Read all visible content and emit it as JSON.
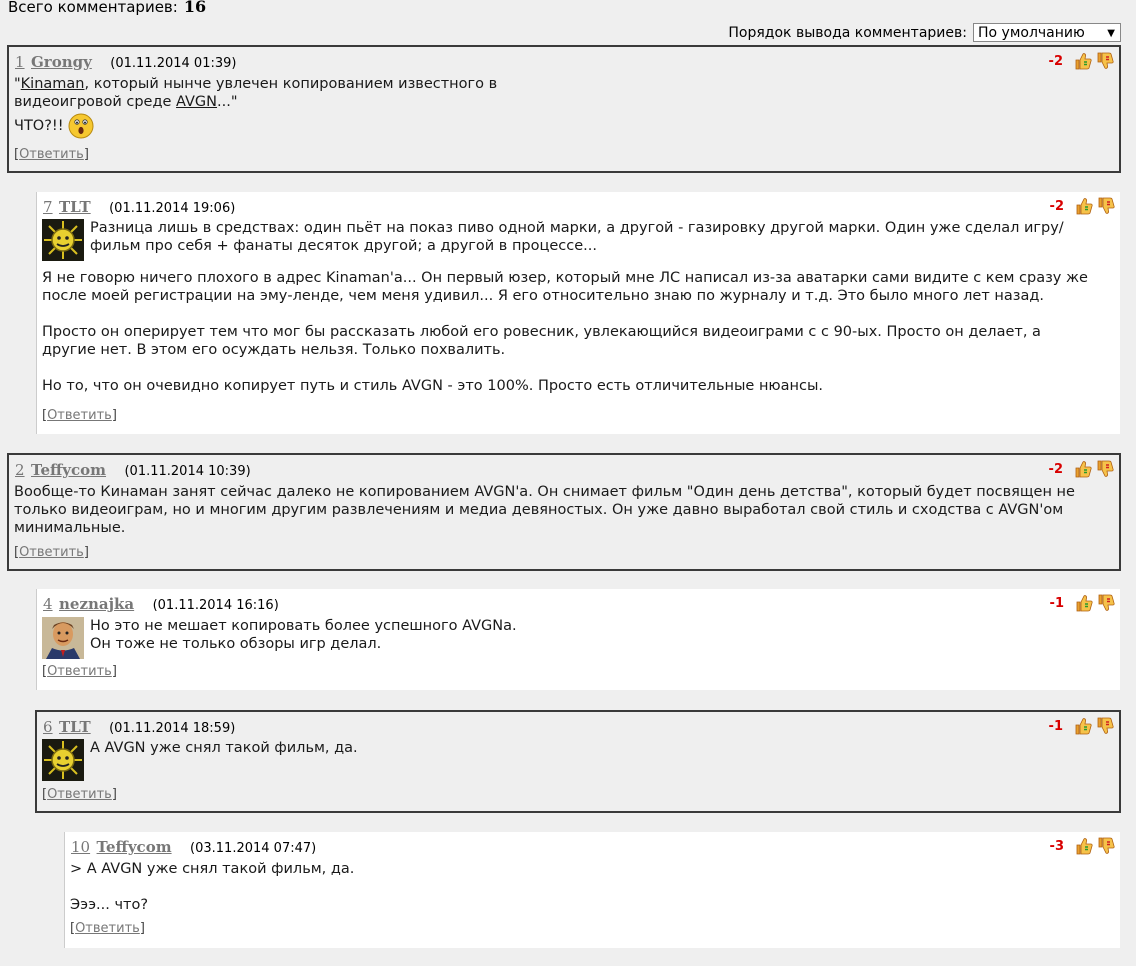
{
  "header": {
    "total_label": "Всего комментариев:",
    "total_count": "16",
    "order_label": "Порядок вывода комментариев:",
    "order_value": "По умолчанию"
  },
  "comments": [
    {
      "num": "1",
      "author": "Grongy",
      "date": "(01.11.2014 01:39)",
      "score": "-2",
      "line1_pre": "\"",
      "link1": "Kinaman",
      "line1_post": ", который нынче увлечен копированием известного в",
      "line2_pre": "видеоигровой среде ",
      "link2": "AVGN",
      "line2_post": "...\"",
      "line3": "ЧТО?!!",
      "reply": "Ответить"
    },
    {
      "num": "7",
      "author": "TLT",
      "date": "(01.11.2014 19:06)",
      "score": "-2",
      "p1": "Разница лишь в средствах: один пьёт на показ пиво одной марки, а другой - газировку другой марки. Один уже сделал игру/фильм про себя + фанаты десяток другой; а другой в процессе...",
      "p2": "Я не говорю ничего плохого в адрес Kinaman'a... Он первый юзер, который мне ЛС написал из-за аватарки сами видите с кем сразу же после моей регистрации на эму-ленде, чем меня удивил... Я его относительно знаю по журналу и т.д. Это было много лет назад.",
      "p3": "Просто он оперирует тем что мог бы рассказать любой его ровесник, увлекающийся видеоиграми с с 90-ых. Просто он делает, а другие нет. В этом его осуждать нельзя. Только похвалить.",
      "p4": "Но то, что он очевидно копирует путь и стиль AVGN - это 100%. Просто есть отличительные нюансы.",
      "reply": "Ответить"
    },
    {
      "num": "2",
      "author": "Teffycom",
      "date": "(01.11.2014 10:39)",
      "score": "-2",
      "p1": "Вообще-то Кинаман занят сейчас далеко не копированием AVGN'a. Он снимает фильм \"Один день детства\", который будет посвящен не только видеоиграм, но и многим другим развлечениям и медиа девяностых. Он уже давно выработал свой стиль и сходства с AVGN'ом минимальные.",
      "reply": "Ответить"
    },
    {
      "num": "4",
      "author": "neznajka",
      "date": "(01.11.2014 16:16)",
      "score": "-1",
      "line1": "Но это не мешает копировать более успешного AVGNа.",
      "line2": "Он тоже не только обзоры игр делал.",
      "reply": "Ответить"
    },
    {
      "num": "6",
      "author": "TLT",
      "date": "(01.11.2014 18:59)",
      "score": "-1",
      "line1": "А AVGN уже снял такой фильм, да.",
      "reply": "Ответить"
    },
    {
      "num": "10",
      "author": "Teffycom",
      "date": "(03.11.2014 07:47)",
      "score": "-3",
      "line1": "> А AVGN уже снял такой фильм, да.",
      "line2": "Эээ... что?",
      "reply": "Ответить"
    }
  ],
  "colors": {
    "score": "#d80000",
    "thumb_up": "#e8a030",
    "thumb_down": "#e8a030",
    "highlight_border": "#3a3a3a"
  }
}
